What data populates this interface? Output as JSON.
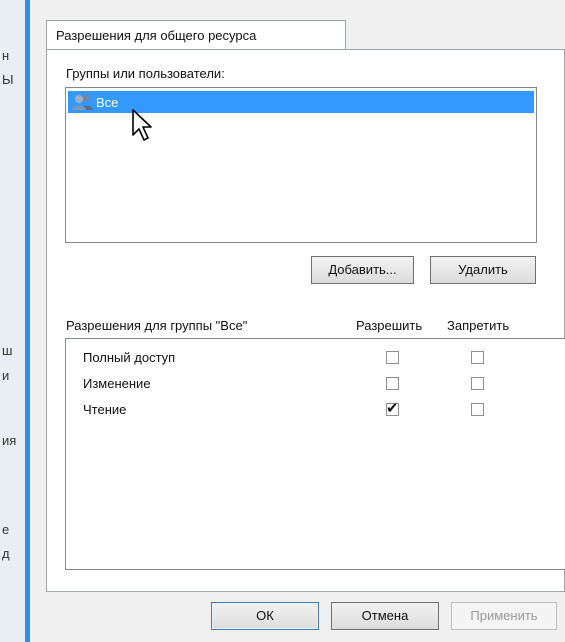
{
  "background": {
    "fragments": [
      "н",
      "Ы",
      "ш",
      "и",
      "ия",
      "е",
      "д"
    ]
  },
  "dialog": {
    "tab_label": "Разрешения для общего ресурса",
    "groups_label": "Группы или пользователи:",
    "users": [
      {
        "name": "Все",
        "selected": true,
        "icon": "users-group-icon"
      }
    ],
    "add_button": "Добавить...",
    "remove_button": "Удалить",
    "permissions_label": "Разрешения для группы \"Все\"",
    "allow_header": "Разрешить",
    "deny_header": "Запретить",
    "permissions": [
      {
        "name": "Полный доступ",
        "allow": false,
        "deny": false
      },
      {
        "name": "Изменение",
        "allow": false,
        "deny": false
      },
      {
        "name": "Чтение",
        "allow": true,
        "deny": false
      }
    ],
    "ok_button": "ОК",
    "cancel_button": "Отмена",
    "apply_button": "Применить"
  },
  "colors": {
    "selection": "#3399ff",
    "accent_edge": "#2f8fe0"
  }
}
